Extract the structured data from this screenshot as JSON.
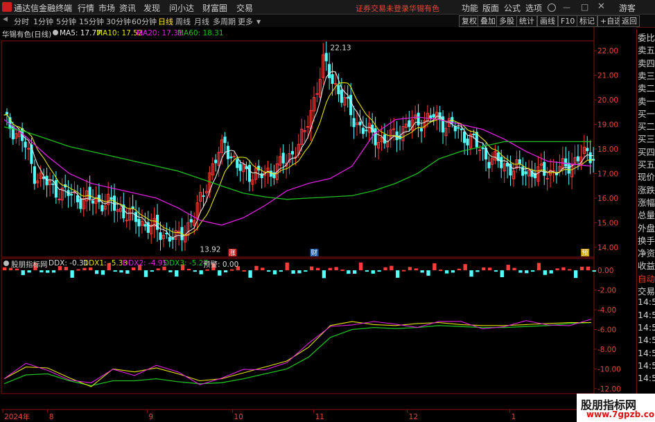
{
  "app": {
    "title": "通达信金融终端",
    "menu": [
      "行情",
      "市场",
      "资讯",
      "发现",
      "问小达",
      "财富圈",
      "交易"
    ],
    "notice": "证券交易未登录",
    "stock_name": "华锡有色",
    "right_menu": [
      "功能",
      "版面",
      "公式",
      "选项"
    ],
    "guest": "游客"
  },
  "periods": [
    "分时",
    "1分钟",
    "5分钟",
    "15分钟",
    "30分钟",
    "60分钟",
    "日线",
    "周线",
    "月线",
    "多周期",
    "更多"
  ],
  "active_period": "日线",
  "tools": [
    "复权",
    "叠加",
    "多股",
    "统计",
    "画线",
    "F10",
    "标记",
    "+自选",
    "返回"
  ],
  "side_panel": [
    "委比",
    "卖五",
    "卖四",
    "卖三",
    "卖二",
    "卖一",
    "买一",
    "买二",
    "买三",
    "买四",
    "买五",
    "现价",
    "涨跌",
    "涨幅",
    "总量",
    "外盘",
    "换手",
    "净资",
    "收益",
    "自动",
    "交易",
    "14:5",
    "14:5",
    "14:5",
    "14:5",
    "14:5",
    "14:5",
    "14:5"
  ],
  "main": {
    "name": "华锡有色(日线)",
    "ma": [
      {
        "label": "MA5: 17.77",
        "color": "#e8e8e8"
      },
      {
        "label": "MA10: 17.52",
        "color": "#e6e600"
      },
      {
        "label": "MA20: 17.31",
        "color": "#e020e0"
      },
      {
        "label": "MA60: 18.31",
        "color": "#20c020"
      }
    ],
    "y_ticks": [
      "22.00",
      "21.00",
      "20.00",
      "19.00",
      "18.00",
      "17.00",
      "16.00",
      "15.00",
      "14.00"
    ],
    "high_label": "22.13",
    "low_label": "13.92",
    "events": [
      "涨",
      "财",
      "预"
    ]
  },
  "indicator": {
    "name": "股朋指标网",
    "values": [
      {
        "label": "DDX: -0.31",
        "color": "#dcdcdc"
      },
      {
        "label": "DDX1: -5.33",
        "color": "#e6e600"
      },
      {
        "label": "DDX2: -4.95",
        "color": "#e020e0"
      },
      {
        "label": "DDX3: -5.27",
        "color": "#20c020"
      },
      {
        "label": "预警: 0.00",
        "color": "#dcdcdc"
      }
    ],
    "y_ticks": [
      "0.00",
      "-2.00",
      "-4.00",
      "-6.00",
      "-8.00",
      "-10.00",
      "-12.00"
    ]
  },
  "x_axis": [
    "2024年",
    "8",
    "9",
    "10",
    "11",
    "12",
    "1"
  ],
  "watermark": {
    "line1": "股朋指标网",
    "line2": "www.7gpzb.com"
  },
  "colors": {
    "up": "#ff3c3c",
    "down": "#54ffff",
    "ma5": "#e8e8e8",
    "ma10": "#e6e600",
    "ma20": "#e020e0",
    "ma60": "#20c020",
    "grid": "#8a1010"
  },
  "chart_data": {
    "type": "line",
    "title": "华锡有色(日线)",
    "y_range_price": [
      13.6,
      22.4
    ],
    "series": [
      {
        "name": "MA60",
        "values": [
          18.9,
          18.7,
          18.4,
          18.1,
          17.9,
          17.7,
          17.5,
          17.3,
          17.1,
          16.8,
          16.5,
          16.2,
          16.05,
          15.95,
          16.0,
          16.05,
          16.1,
          16.3,
          16.6,
          17.0,
          17.6,
          17.9,
          18.1,
          18.3,
          18.3,
          18.3,
          18.3,
          18.3
        ]
      },
      {
        "name": "MA20",
        "values": [
          19.2,
          18.5,
          17.7,
          17.0,
          16.6,
          16.4,
          16.2,
          16.0,
          15.6,
          15.1,
          14.9,
          15.2,
          15.7,
          16.3,
          16.6,
          16.8,
          17.3,
          18.6,
          19.2,
          19.3,
          19.2,
          19.0,
          18.8,
          18.4,
          17.9,
          17.5,
          17.4,
          17.3
        ]
      },
      {
        "name": "DDX1",
        "values": [
          -11.0,
          -9.8,
          -9.9,
          -10.9,
          -11.8,
          -10.0,
          -10.3,
          -9.9,
          -10.5,
          -11.2,
          -11.0,
          -10.4,
          -9.8,
          -9.2,
          -7.8,
          -5.6,
          -5.2,
          -5.5,
          -5.6,
          -5.4,
          -5.3,
          -5.5,
          -5.6,
          -5.6,
          -5.5,
          -5.4,
          -5.3,
          -5.3
        ]
      },
      {
        "name": "DDX3",
        "values": [
          -11.5,
          -10.6,
          -10.5,
          -11.2,
          -11.7,
          -11.2,
          -11.2,
          -11.0,
          -11.3,
          -11.5,
          -11.4,
          -11.0,
          -10.5,
          -10.0,
          -8.8,
          -6.8,
          -6.0,
          -5.8,
          -5.9,
          -5.8,
          -5.6,
          -5.7,
          -5.8,
          -5.8,
          -5.7,
          -5.6,
          -5.4,
          -5.3
        ]
      }
    ]
  }
}
